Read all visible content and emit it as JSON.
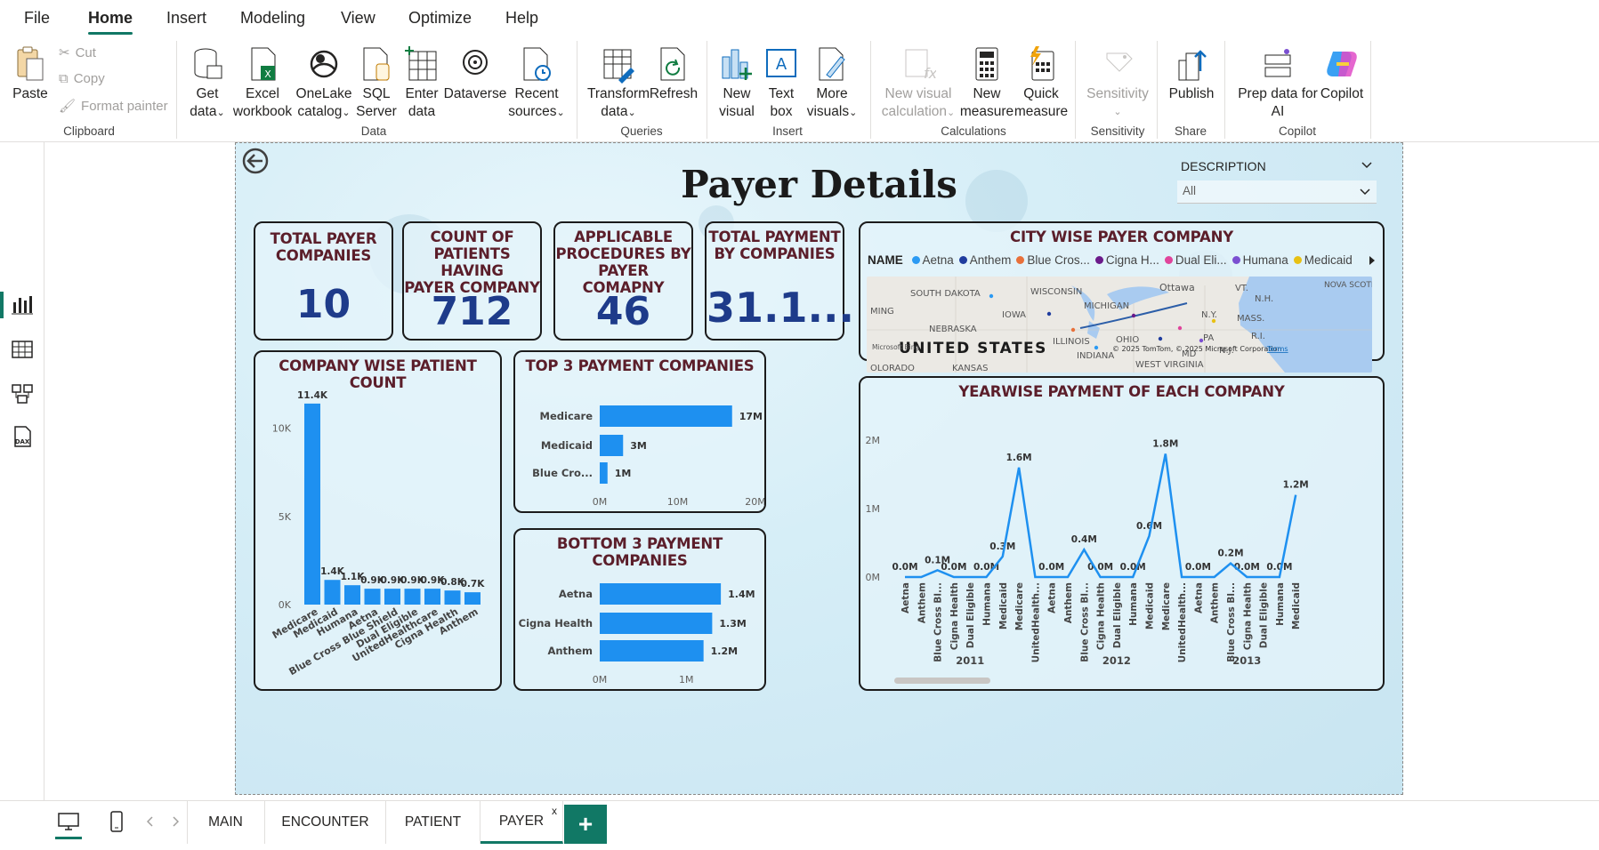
{
  "menu": {
    "items": [
      "File",
      "Home",
      "Insert",
      "Modeling",
      "View",
      "Optimize",
      "Help"
    ],
    "active": "Home"
  },
  "ribbon": {
    "clipboard": {
      "paste": "Paste",
      "cut": "Cut",
      "copy": "Copy",
      "format_painter": "Format painter",
      "group": "Clipboard"
    },
    "data": {
      "get_data": [
        "Get",
        "data"
      ],
      "excel": [
        "Excel",
        "workbook"
      ],
      "onelake": [
        "OneLake",
        "catalog"
      ],
      "sql": [
        "SQL",
        "Server"
      ],
      "enter": [
        "Enter",
        "data"
      ],
      "dataverse": "Dataverse",
      "recent": [
        "Recent",
        "sources"
      ],
      "group": "Data"
    },
    "queries": {
      "transform": [
        "Transform",
        "data"
      ],
      "refresh": "Refresh",
      "group": "Queries"
    },
    "insert": {
      "new_visual": [
        "New",
        "visual"
      ],
      "text_box": [
        "Text",
        "box"
      ],
      "more_visuals": [
        "More",
        "visuals"
      ],
      "group": "Insert"
    },
    "calculations": {
      "new_visual_calc": [
        "New visual",
        "calculation"
      ],
      "new_measure": [
        "New",
        "measure"
      ],
      "quick_measure": [
        "Quick",
        "measure"
      ],
      "group": "Calculations"
    },
    "sensitivity": {
      "label": "Sensitivity",
      "group": "Sensitivity"
    },
    "share": {
      "publish": "Publish",
      "group": "Share"
    },
    "copilot": {
      "prep": [
        "Prep data for",
        "AI"
      ],
      "copilot": "Copilot",
      "group": "Copilot"
    }
  },
  "report": {
    "title": "Payer Details",
    "slicer": {
      "label": "DESCRIPTION",
      "value": "All"
    },
    "kpis": [
      {
        "title": [
          "TOTAL PAYER",
          "COMPANIES"
        ],
        "value": "10"
      },
      {
        "title": [
          "COUNT OF",
          "PATIENTS HAVING",
          "PAYER COMPANY"
        ],
        "value": "712"
      },
      {
        "title": [
          "APPLICABLE",
          "PROCEDURES BY",
          "PAYER COMAPNY"
        ],
        "value": "46"
      },
      {
        "title": [
          "TOTAL PAYMENT",
          "BY COMPANIES"
        ],
        "value": "31.1..."
      }
    ],
    "map": {
      "title": "CITY WISE PAYER COMPANY",
      "legend_label": "NAME",
      "legend": [
        {
          "name": "Aetna",
          "color": "#2b9af3"
        },
        {
          "name": "Anthem",
          "color": "#1f3c9e"
        },
        {
          "name": "Blue Cros...",
          "color": "#e8703a"
        },
        {
          "name": "Cigna H...",
          "color": "#6b1a8a"
        },
        {
          "name": "Dual Eli...",
          "color": "#e0449b"
        },
        {
          "name": "Humana",
          "color": "#7b4fd1"
        },
        {
          "name": "Medicaid",
          "color": "#e8c114"
        }
      ],
      "labels": [
        "SOUTH DAKOTA",
        "WISCONSIN",
        "MICHIGAN",
        "Ottawa",
        "VT.",
        "N.H.",
        "NOVA SCOTIA",
        "MING",
        "IOWA",
        "N.Y.",
        "MASS.",
        "NEBRASKA",
        "ILLINOIS",
        "OHIO",
        "PA",
        "R.I.",
        "UNITED STATES",
        "INDIANA",
        "N.J.",
        "MD",
        "WEST VIRGINIA",
        "KANSAS",
        "OLORADO"
      ],
      "attribution": "© 2025 TomTom, © 2025 Microsoft Corporation",
      "terms": "Terms",
      "bing": "Microsoft Bing"
    },
    "company_patient": {
      "title": "COMPANY WISE PATIENT COUNT",
      "categories": [
        "Medicare",
        "Medicaid",
        "Humana",
        "Aetna",
        "Blue Cross Blue Shield",
        "Dual Eligible",
        "UnitedHealthcare",
        "Cigna Health",
        "Anthem"
      ],
      "values": [
        11400,
        1400,
        1100,
        900,
        900,
        900,
        900,
        800,
        700
      ],
      "labels": [
        "11.4K",
        "1.4K",
        "1.1K",
        "0.9K",
        "0.9K",
        "0.9K",
        "0.9K",
        "0.8K",
        "0.7K"
      ],
      "yticks": [
        "0K",
        "5K",
        "10K"
      ],
      "ymax": 12000
    },
    "top3": {
      "title": "TOP 3 PAYMENT COMPANIES",
      "categories": [
        "Medicare",
        "Medicaid",
        "Blue Cro..."
      ],
      "values": [
        17,
        3,
        1
      ],
      "labels": [
        "17M",
        "3M",
        "1M"
      ],
      "xticks": [
        "0M",
        "10M",
        "20M"
      ],
      "xmax": 20
    },
    "bottom3": {
      "title": "BOTTOM 3 PAYMENT COMPANIES",
      "categories": [
        "Aetna",
        "Cigna Health",
        "Anthem"
      ],
      "values": [
        1.4,
        1.3,
        1.2
      ],
      "labels": [
        "1.4M",
        "1.3M",
        "1.2M"
      ],
      "xticks": [
        "0M",
        "1M"
      ],
      "xmax": 1.8
    },
    "yearwise": {
      "title": "YEARWISE PAYMENT OF EACH COMPANY",
      "yticks": [
        "0M",
        "1M",
        "2M"
      ],
      "ymax": 2.0,
      "years": [
        {
          "year": "2011",
          "categories": [
            "Aetna",
            "Anthem",
            "Blue Cross Bl...",
            "Cigna Health",
            "Dual Eligible",
            "Humana",
            "Medicaid",
            "Medicare",
            "UnitedHealth..."
          ],
          "values": [
            0.0,
            0.0,
            0.1,
            0.0,
            0.0,
            0.0,
            0.3,
            1.6,
            0.0
          ],
          "labels": [
            "0.0M",
            "",
            "0.1M",
            "0.0M",
            "",
            "0.0M",
            "0.3M",
            "1.6M",
            ""
          ]
        },
        {
          "year": "2012",
          "categories": [
            "Aetna",
            "Anthem",
            "Blue Cross Bl...",
            "Cigna Health",
            "Dual Eligible",
            "Humana",
            "Medicaid",
            "Medicare",
            "UnitedHealth..."
          ],
          "values": [
            0.0,
            0.0,
            0.4,
            0.0,
            0.0,
            0.0,
            0.6,
            1.8,
            0.0
          ],
          "labels": [
            "0.0M",
            "",
            "0.4M",
            "0.0M",
            "",
            "0.0M",
            "0.6M",
            "1.8M",
            ""
          ]
        },
        {
          "year": "2013",
          "categories": [
            "Aetna",
            "Anthem",
            "Blue Cross Bl...",
            "Cigna Health",
            "Dual Eligible",
            "Humana",
            "Medicaid"
          ],
          "values": [
            0.0,
            0.0,
            0.2,
            0.0,
            0.0,
            0.0,
            1.2
          ],
          "labels": [
            "0.0M",
            "",
            "0.2M",
            "0.0M",
            "",
            "0.0M",
            "1.2M"
          ]
        }
      ]
    }
  },
  "pages": {
    "tabs": [
      "MAIN",
      "ENCOUNTER",
      "PATIENT",
      "PAYER"
    ],
    "active": "PAYER",
    "add": "+",
    "close": "x"
  },
  "chart_data": [
    {
      "type": "bar",
      "title": "COMPANY WISE PATIENT COUNT",
      "categories": [
        "Medicare",
        "Medicaid",
        "Humana",
        "Aetna",
        "Blue Cross Blue Shield",
        "Dual Eligible",
        "UnitedHealthcare",
        "Cigna Health",
        "Anthem"
      ],
      "values": [
        11400,
        1400,
        1100,
        900,
        900,
        900,
        900,
        800,
        700
      ],
      "ylim": [
        0,
        12000
      ]
    },
    {
      "type": "bar",
      "title": "TOP 3 PAYMENT COMPANIES",
      "categories": [
        "Medicare",
        "Medicaid",
        "Blue Cro..."
      ],
      "values": [
        17,
        3,
        1
      ],
      "xlim": [
        0,
        20
      ]
    },
    {
      "type": "bar",
      "title": "BOTTOM 3 PAYMENT COMPANIES",
      "categories": [
        "Aetna",
        "Cigna Health",
        "Anthem"
      ],
      "values": [
        1.4,
        1.3,
        1.2
      ],
      "xlim": [
        0,
        1.8
      ]
    },
    {
      "type": "line",
      "title": "YEARWISE PAYMENT OF EACH COMPANY",
      "series": [
        {
          "values": [
            0.0,
            0.0,
            0.1,
            0.0,
            0.0,
            0.0,
            0.3,
            1.6,
            0.0,
            0.0,
            0.0,
            0.4,
            0.0,
            0.0,
            0.0,
            0.6,
            1.8,
            0.0,
            0.0,
            0.0,
            0.2,
            0.0,
            0.0,
            0.0,
            1.2
          ]
        }
      ],
      "ylim": [
        0,
        2
      ]
    }
  ]
}
